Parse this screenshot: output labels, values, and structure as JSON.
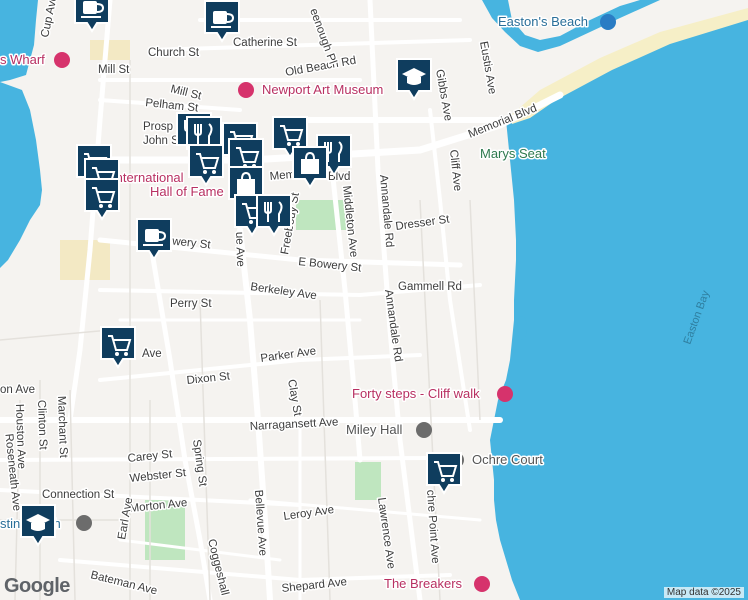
{
  "colors": {
    "water": "#47b4e0",
    "land": "#f5f3f0",
    "road": "#ffffff",
    "minor_road": "#dfdcd7",
    "park": "#bfe6bf",
    "beach": "#f6efc7",
    "marker": "#0f3d5e",
    "poi_red": "#d6336c",
    "poi_gray": "#6c6c6c"
  },
  "attribution": {
    "text": "Map data ©2025"
  },
  "logo": {
    "text": "Google"
  },
  "streets": {
    "church": "Church St",
    "catherine": "Catherine St",
    "old_beach": "Old Beach Rd",
    "mill1": "Mill St",
    "mill2": "Mill St",
    "pelham": "Pelham St",
    "prospect": "Prosp",
    "john": "John S",
    "greenough": "eenough Pl",
    "memorial": "Memorial Blvd",
    "memorial2": "Mem",
    "memorial3": "Blvd",
    "eustis": "Eustis Ave",
    "gibbs": "Gibbs Ave",
    "cliff": "Cliff Ave",
    "annandale1": "Annandale Rd",
    "annandale2": "Annandale Rd",
    "middleton": "Middleton Ave",
    "freebody": "Freebody St",
    "dresser": "Dresser St",
    "bowery": "Bowery St",
    "e_bowery": "E Bowery St",
    "gammell": "Gammell Rd",
    "berkeley": "Berkeley Ave",
    "perry": "Perry St",
    "parker": "Parker Ave",
    "dixon": "Dixon St",
    "clay": "Clay St",
    "ave_frag": "Ave",
    "ue_ave": "ue Ave",
    "narragansett": "Narragansett Ave",
    "carey": "Carey St",
    "webster": "Webster St",
    "connection": "Connection St",
    "morton": "Morton Ave",
    "leroy": "Leroy Ave",
    "lawrence": "Lawrence Ave",
    "ochre_point": "chre Point Ave",
    "spring": "Spring St",
    "bellevue": "Bellevue Ave",
    "coggeshall": "Coggeshall",
    "earl": "Earl Ave",
    "bateman": "Bateman Ave",
    "shepard": "Shepard Ave",
    "marchant": "Marchant St",
    "clinton": "Clinton St",
    "houston": "Houston Ave",
    "roseneath": "Roseneath Ave",
    "on_ave": "on Ave",
    "cup_ave": "Cup Ave"
  },
  "places": {
    "eastons_beach": "Easton's Beach",
    "newport_art": "Newport Art Museum",
    "marys_seat": "Marys Seat",
    "forty_steps": "Forty steps - Cliff walk",
    "miley_hall": "Miley Hall",
    "ochre_court": "Ochre Court",
    "the_breakers": "The Breakers",
    "hall_of_fame_1": "International",
    "hall_of_fame_2": "Hall of Fame",
    "wharf": "s Wharf",
    "beach_frag": "stin Beach"
  },
  "water_labels": {
    "easton_bay": "Easton Bay"
  }
}
